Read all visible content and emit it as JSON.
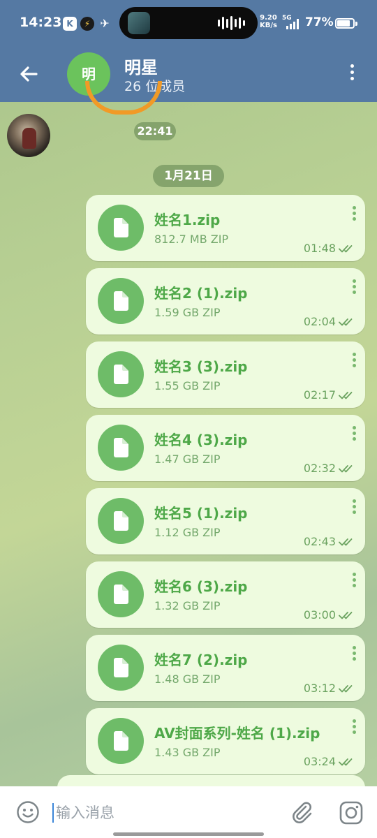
{
  "status_bar": {
    "time": "14:23",
    "app_k": "K",
    "app_q": "⚡",
    "app_t": "✈",
    "net_speed_top": "9.20",
    "net_speed_bottom": "KB/s",
    "network": "5G",
    "battery": "77%"
  },
  "header": {
    "avatar_letter": "明",
    "title": "明星",
    "subtitle": "26 位成员"
  },
  "chat": {
    "time_pill": "22:41",
    "date_pill": "1月21日",
    "messages": [
      {
        "name": "姓名1.zip",
        "size": "812.7 MB ZIP",
        "time": "01:48"
      },
      {
        "name": "姓名2 (1).zip",
        "size": "1.59 GB ZIP",
        "time": "02:04"
      },
      {
        "name": "姓名3 (3).zip",
        "size": "1.55 GB ZIP",
        "time": "02:17"
      },
      {
        "name": "姓名4 (3).zip",
        "size": "1.47 GB ZIP",
        "time": "02:32"
      },
      {
        "name": "姓名5 (1).zip",
        "size": "1.12 GB ZIP",
        "time": "02:43"
      },
      {
        "name": "姓名6 (3).zip",
        "size": "1.32 GB ZIP",
        "time": "03:00"
      },
      {
        "name": "姓名7 (2).zip",
        "size": "1.48 GB ZIP",
        "time": "03:12"
      },
      {
        "name": "AV封面系列-姓名 (1).zip",
        "size": "1.43 GB ZIP",
        "time": "03:24"
      }
    ]
  },
  "input": {
    "placeholder": "输入消息"
  },
  "colors": {
    "header": "#5579a3",
    "bubble": "#eefbdf",
    "file_icon": "#6ebc68",
    "accent_text": "#4ea848"
  }
}
